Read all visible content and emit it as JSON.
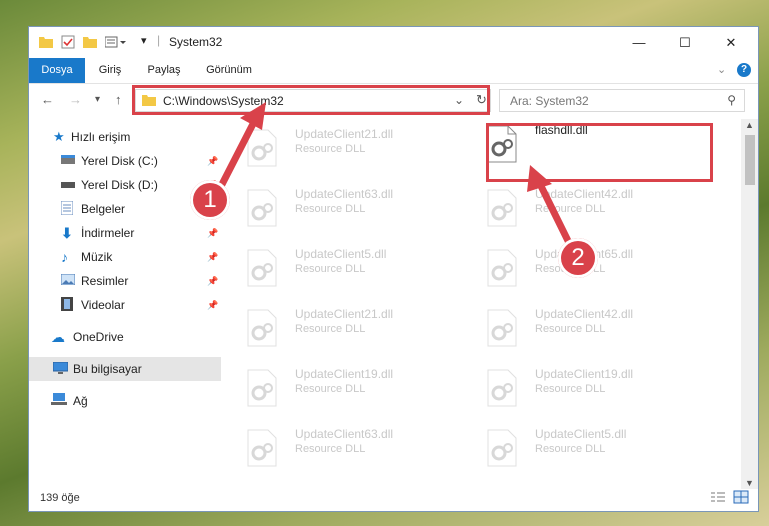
{
  "window": {
    "title": "System32",
    "controls": {
      "minimize": "—",
      "maximize": "☐",
      "close": "✕"
    }
  },
  "ribbon": {
    "tabs": [
      "Dosya",
      "Giriş",
      "Paylaş",
      "Görünüm"
    ],
    "active_tab": "Dosya"
  },
  "address_bar": {
    "path": "C:\\Windows\\System32",
    "search_placeholder": "Ara: System32"
  },
  "sidebar": {
    "items": [
      {
        "label": "Hızlı erişim",
        "icon": "star-icon",
        "pinned": false
      },
      {
        "label": "Yerel Disk (C:)",
        "icon": "drive-icon",
        "pinned": true
      },
      {
        "label": "Yerel Disk (D:)",
        "icon": "drive-icon",
        "pinned": true
      },
      {
        "label": "Belgeler",
        "icon": "document-icon",
        "pinned": true
      },
      {
        "label": "İndirmeler",
        "icon": "download-icon",
        "pinned": true
      },
      {
        "label": "Müzik",
        "icon": "music-icon",
        "pinned": true
      },
      {
        "label": "Resimler",
        "icon": "pictures-icon",
        "pinned": true
      },
      {
        "label": "Videolar",
        "icon": "video-icon",
        "pinned": true
      },
      {
        "label": "OneDrive",
        "icon": "cloud-icon",
        "pinned": false
      },
      {
        "label": "Bu bilgisayar",
        "icon": "computer-icon",
        "pinned": false,
        "selected": true
      },
      {
        "label": "Ağ",
        "icon": "network-icon",
        "pinned": false
      }
    ]
  },
  "files": {
    "left_column": [
      {
        "name": "UpdateClient21.dll",
        "type": "Resource DLL"
      },
      {
        "name": "UpdateClient63.dll",
        "type": "Resource DLL"
      },
      {
        "name": "UpdateClient5.dll",
        "type": "Resource DLL"
      },
      {
        "name": "UpdateClient21.dll",
        "type": "Resource DLL"
      },
      {
        "name": "UpdateClient19.dll",
        "type": "Resource DLL"
      },
      {
        "name": "UpdateClient63.dll",
        "type": "Resource DLL"
      }
    ],
    "right_column": [
      {
        "name": "flashdll.dll",
        "type": ""
      },
      {
        "name": "UpdateClient42.dll",
        "type": "Resource DLL"
      },
      {
        "name": "UpdateClient65.dll",
        "type": "Resource DLL"
      },
      {
        "name": "UpdateClient42.dll",
        "type": "Resource DLL"
      },
      {
        "name": "UpdateClient19.dll",
        "type": "Resource DLL"
      },
      {
        "name": "UpdateClient5.dll",
        "type": "Resource DLL"
      }
    ]
  },
  "status_bar": {
    "item_count": "139 öğe"
  },
  "annotations": {
    "badge1": "1",
    "badge2": "2",
    "highlight_color": "#d9424a"
  }
}
